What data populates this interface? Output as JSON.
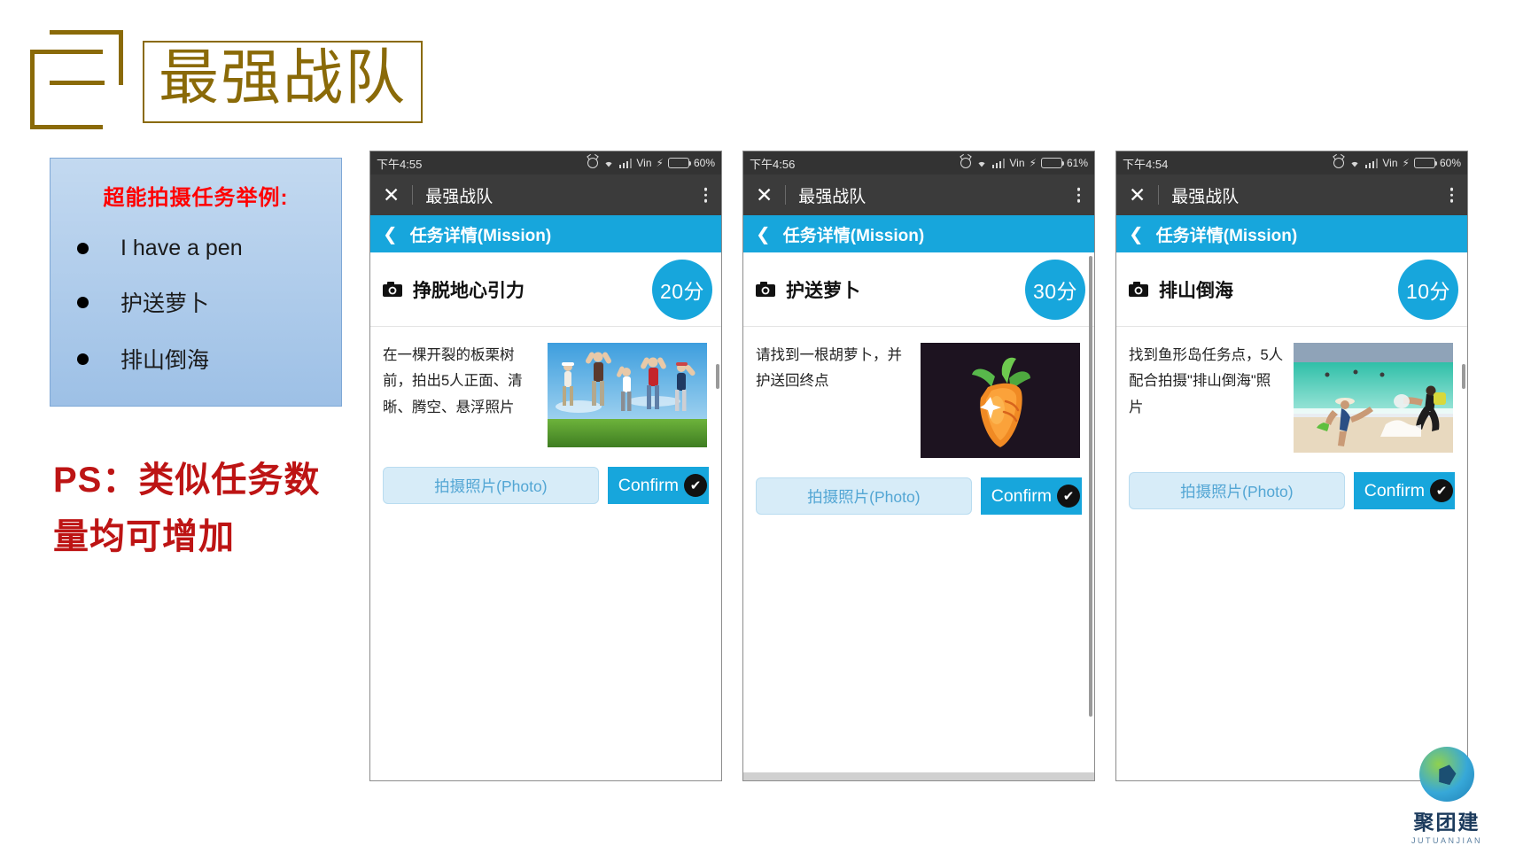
{
  "brand": {
    "logo_name": "zuiqiang-zhandui-logo",
    "title": "最强战队",
    "color": "#8a6a08"
  },
  "info_panel": {
    "title": "超能拍摄任务举例:",
    "title_color": "#ff0000",
    "items": [
      {
        "label": "I have a pen"
      },
      {
        "label": "护送萝卜"
      },
      {
        "label": "排山倒海"
      }
    ]
  },
  "ps_note": {
    "text": "PS：类似任务数量均可增加",
    "color": "#bd1414"
  },
  "phones": [
    {
      "status": {
        "time": "下午4:55",
        "carrier": "Vin",
        "battery": "60%",
        "battery_level": 60
      },
      "appbar": {
        "close_label": "✕",
        "title": "最强战队"
      },
      "navbar": {
        "back_label": "❮",
        "title": "任务详情(Mission)"
      },
      "mission": {
        "name": "挣脱地心引力",
        "score": "20分",
        "description": "在一棵开裂的板栗树前，拍出5人正面、清晰、腾空、悬浮照片",
        "photo_name": "jumping-people-photo"
      },
      "actions": {
        "photo_label": "拍摄照片(Photo)",
        "confirm_label": "Confirm"
      }
    },
    {
      "status": {
        "time": "下午4:56",
        "carrier": "Vin",
        "battery": "61%",
        "battery_level": 61
      },
      "appbar": {
        "close_label": "✕",
        "title": "最强战队"
      },
      "navbar": {
        "back_label": "❮",
        "title": "任务详情(Mission)"
      },
      "mission": {
        "name": "护送萝卜",
        "score": "30分",
        "description": "请找到一根胡萝卜，并护送回终点",
        "photo_name": "carrot-photo"
      },
      "actions": {
        "photo_label": "拍摄照片(Photo)",
        "confirm_label": "Confirm"
      }
    },
    {
      "status": {
        "time": "下午4:54",
        "carrier": "Vin",
        "battery": "60%",
        "battery_level": 60
      },
      "appbar": {
        "close_label": "✕",
        "title": "最强战队"
      },
      "navbar": {
        "back_label": "❮",
        "title": "任务详情(Mission)"
      },
      "mission": {
        "name": "排山倒海",
        "score": "10分",
        "description": "找到鱼形岛任务点，5人配合拍摄\"排山倒海\"照片",
        "photo_name": "beach-photo"
      },
      "actions": {
        "photo_label": "拍摄照片(Photo)",
        "confirm_label": "Confirm"
      }
    }
  ],
  "footer_logo": {
    "name": "聚团建",
    "sub": "JUTUANJIAN"
  },
  "colors": {
    "accent_blue": "#17a6dc",
    "appbar_gray": "#3b3b3b",
    "statusbar_gray": "#333333"
  }
}
